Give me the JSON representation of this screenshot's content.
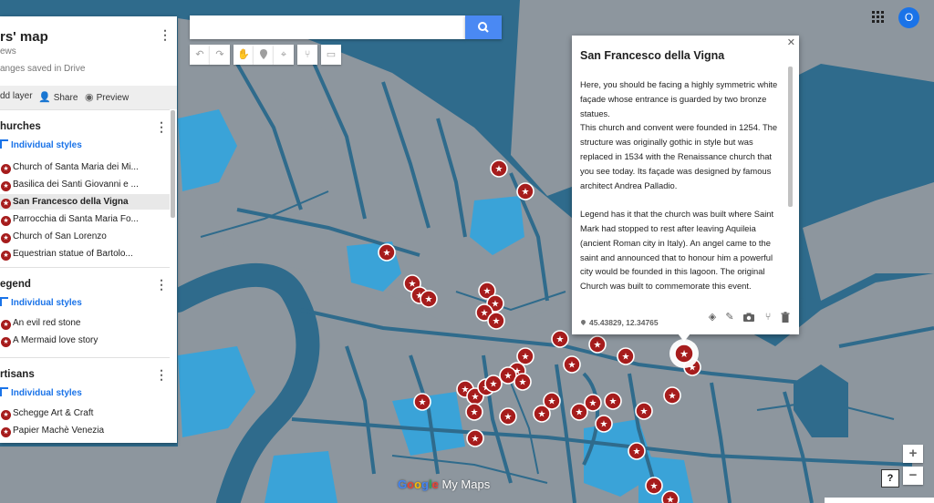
{
  "map": {
    "colors": {
      "water": "#2f6b8c",
      "land": "#8d969e",
      "park": "#3aa3d8",
      "marker": "#a61c1c",
      "marker_selected_ring": "#ffffff"
    },
    "markers_visible": 56
  },
  "panel": {
    "title": "rs' map",
    "subtitle": "ews",
    "saved_status": "anges saved in Drive",
    "actions": {
      "add_layer": "dd layer",
      "share": "Share",
      "preview": "Preview"
    },
    "layers": [
      {
        "title": "hurches",
        "styles": "Individual styles",
        "items": [
          {
            "label": "Church of Santa Maria dei Mi..."
          },
          {
            "label": "Basilica dei Santi Giovanni e ..."
          },
          {
            "label": "San Francesco della Vigna",
            "selected": true
          },
          {
            "label": "Parrocchia di Santa Maria Fo..."
          },
          {
            "label": "Church of San Lorenzo"
          },
          {
            "label": "Equestrian statue of Bartolo..."
          }
        ]
      },
      {
        "title": "egend",
        "styles": "Individual styles",
        "items": [
          {
            "label": "An evil red stone"
          },
          {
            "label": "A Mermaid love story"
          }
        ]
      },
      {
        "title": "rtisans",
        "styles": "Individual styles",
        "items": [
          {
            "label": "Schegge Art & Craft"
          },
          {
            "label": "Papier Machè Venezia"
          }
        ]
      }
    ]
  },
  "search": {
    "value": "",
    "placeholder": ""
  },
  "account": {
    "initial": "O"
  },
  "info": {
    "title": "San Francesco della Vigna",
    "paragraph1": "Here, you should be facing a highly symmetric white façade whose entrance is guarded by two bronze statues.",
    "paragraph2": "This church and convent were founded in 1254. The structure was originally gothic in style but was replaced in 1534 with the Renaissance church that you see today. Its façade was designed by famous architect Andrea Palladio.",
    "paragraph3": "Legend has it that the church was built where Saint Mark had stopped to rest after leaving Aquileia (ancient Roman city in Italy). An angel came to the saint and announced that to honour him a powerful city would be founded in this lagoon. The original Church was built to commemorate this event.",
    "coordinates": "45.43829, 12.34765"
  },
  "controls": {
    "zoom_in": "+",
    "zoom_out": "−",
    "help": "?"
  },
  "logo": {
    "brand": "Google",
    "product": "My Maps"
  }
}
